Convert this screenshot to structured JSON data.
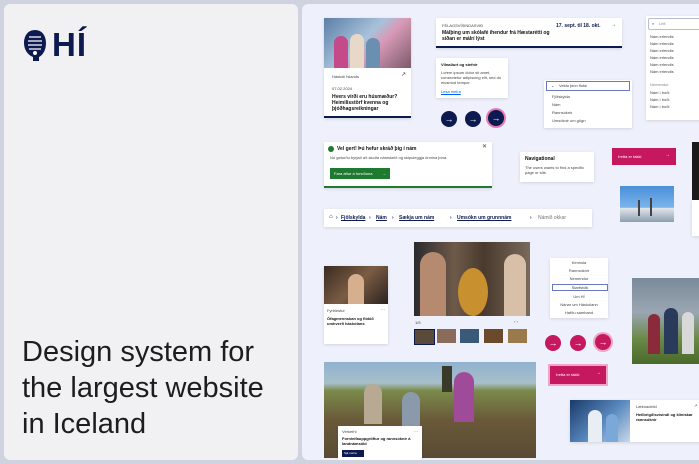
{
  "logo": {
    "text": "HÍ"
  },
  "headline": "Design system for the largest website in Iceland",
  "colors": {
    "navy": "#0c1a4f",
    "pink": "#c5185f",
    "green": "#1e7a2e",
    "link": "#0061ff"
  },
  "news_card": {
    "source": "Háskóli Íslands",
    "date": "07.02.2024",
    "title": "Hvers virði eru húsmæður? Heimilisstörf kvenna og þjóðhagsreikningar"
  },
  "event_card": {
    "label": "FÉLAGSVÍSINDASVIÐ",
    "date": "17. sept. til 18. okt.",
    "title": "Málþing um skólafé íhendur frá Hæstarétti og síðan er málrí lýst"
  },
  "info_card": {
    "title": "Vilnaðurt og stefnir",
    "body": "Lorem ipsum dolor sit amet, consectetur adipiscing elit, sed do eiusmod tempor.",
    "link": "Lesa meira"
  },
  "dropdown": {
    "selected": "Veldu þinn flokk",
    "options": [
      "Fjölskylda",
      "Nám",
      "Rannsóknir",
      "Umsóknir um gögn"
    ]
  },
  "search_panel": {
    "placeholder": "Leit",
    "results": [
      "Nám erlendis",
      "Nám erlendis",
      "Nám erlendis",
      "Nám erlendis",
      "Nám erlendis",
      "Nám erlendis"
    ],
    "section": "Nemendur",
    "links": [
      "Nám í boði",
      "Nám í boði",
      "Nám í boði"
    ]
  },
  "alert": {
    "title": "Vel gert! Þú hefur skráð þig í nám",
    "body": "Nú geturðu byrjað að skoða námskeið og skipuleggja önnina þína.",
    "button": "Fara aftur á forsíðuna"
  },
  "tooltip": {
    "title": "Navigational",
    "body": "The users wants to find a specific page or site."
  },
  "pink_button": {
    "label": "Þetta er takki"
  },
  "pink_button_2": {
    "label": "Þetta er takki"
  },
  "breadcrumb": {
    "home_icon": "home-icon",
    "items": [
      "Fjölskylda",
      "Nám",
      "Sækja um nám",
      "Umsókn um grunnnám"
    ],
    "current": "Námið okkar"
  },
  "video_card": {
    "label": "Fyrirlestur",
    "title": "Ófagmennskan og flókið umhverfi háskólans"
  },
  "side_menu": {
    "items": [
      "Kennsla",
      "Rannsóknir",
      "Nemendur",
      "Starfsfólk",
      "Um HÍ",
      "Nánar um Háskólann",
      "Hafðu samband"
    ]
  },
  "bottom_card": {
    "label": "Verkefni",
    "title": "Fornleifauppgröftur og rannsóknir á landnámsöld",
    "button": "Sjá meira"
  },
  "doctor_card": {
    "label": "Læknadeild",
    "title": "Heilbrigðisvísindi og klínískar rannsóknir"
  }
}
